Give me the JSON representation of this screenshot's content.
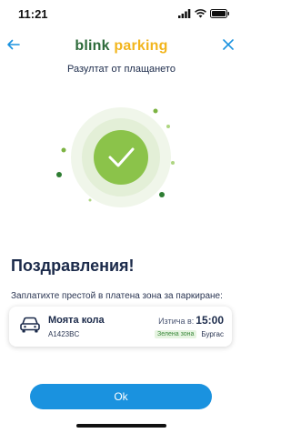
{
  "status_bar": {
    "time": "11:21",
    "icons": [
      "signal-icon",
      "wifi-icon",
      "battery-icon"
    ]
  },
  "header": {
    "logo_part1": "blink",
    "logo_part2": "parking",
    "title": "Разултат от плащането",
    "back_icon": "arrow-left-icon",
    "close_icon": "close-icon"
  },
  "result": {
    "icon": "checkmark-icon",
    "heading": "Поздравления!",
    "message": "Заплатихте престой в платена зона за паркиране:"
  },
  "parking_card": {
    "vehicle_name": "Моята кола",
    "plate": "A1423BC",
    "expires_label": "Изтича в:",
    "expires_time": "15:00",
    "zone": "Зелена зона",
    "city": "Бургас"
  },
  "actions": {
    "ok_label": "Ok"
  },
  "colors": {
    "accent": "#1a92df",
    "success": "#8bc34a",
    "brand_green": "#2d6a3a",
    "brand_yellow": "#f2b51d",
    "text": "#1b2a4a"
  }
}
